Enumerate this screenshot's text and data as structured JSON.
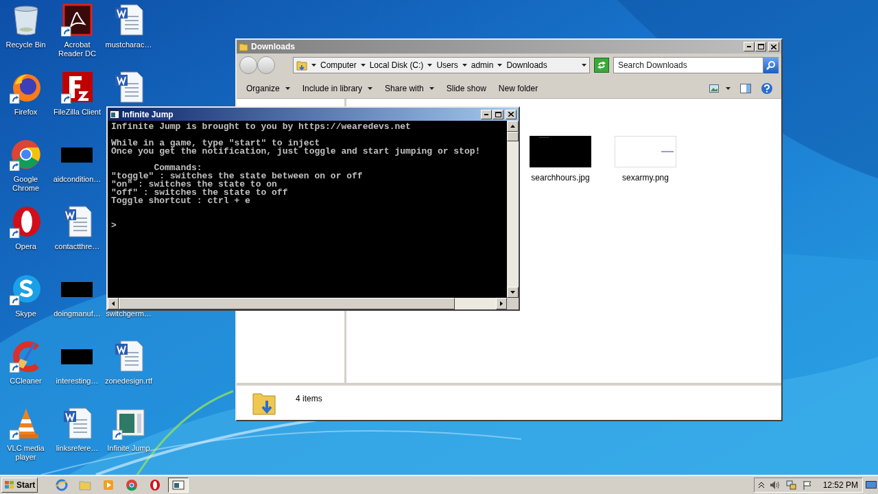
{
  "desktop": {
    "columns": [
      [
        {
          "label": "Recycle Bin",
          "kind": "recycle",
          "shortcut": false
        },
        {
          "label": "Firefox",
          "kind": "firefox",
          "shortcut": true
        },
        {
          "label": "Google Chrome",
          "kind": "chrome",
          "shortcut": true
        },
        {
          "label": "Opera",
          "kind": "opera",
          "shortcut": true
        },
        {
          "label": "Skype",
          "kind": "skype",
          "shortcut": true
        },
        {
          "label": "CCleaner",
          "kind": "ccleaner",
          "shortcut": true
        },
        {
          "label": "VLC media player",
          "kind": "vlc",
          "shortcut": true
        }
      ],
      [
        {
          "label": "Acrobat Reader DC",
          "kind": "acrobat",
          "shortcut": true
        },
        {
          "label": "FileZilla Client",
          "kind": "filezilla",
          "shortcut": true
        },
        {
          "label": "aidcondition…",
          "kind": "darkimage",
          "shortcut": false
        },
        {
          "label": "contactthre…",
          "kind": "word",
          "shortcut": false
        },
        {
          "label": "doingmanuf…",
          "kind": "darkimage",
          "shortcut": false
        },
        {
          "label": "interesting…",
          "kind": "darkimage",
          "shortcut": false
        },
        {
          "label": "linksrefere…",
          "kind": "word",
          "shortcut": false
        }
      ],
      [
        {
          "label": "mustcharac…",
          "kind": "word",
          "shortcut": false
        },
        {
          "kind": "word",
          "shortcut": false
        },
        {
          "kind": "none"
        },
        {
          "kind": "none"
        },
        {
          "label": "switchgerm…",
          "kind": "none"
        },
        {
          "label": "zonedesign.rtf",
          "kind": "word",
          "shortcut": false
        },
        {
          "label": "Infinite Jump",
          "kind": "app",
          "shortcut": true
        }
      ]
    ]
  },
  "explorer": {
    "title": "Downloads",
    "active": false,
    "breadcrumb": [
      "Computer",
      "Local Disk (C:)",
      "Users",
      "admin",
      "Downloads"
    ],
    "search": {
      "placeholder": "Search Downloads"
    },
    "toolbar": [
      {
        "label": "Organize",
        "menu": true
      },
      {
        "label": "Include in library",
        "menu": true
      },
      {
        "label": "Share with",
        "menu": true
      },
      {
        "label": "Slide show",
        "menu": false
      },
      {
        "label": "New folder",
        "menu": false
      }
    ],
    "files": [
      {
        "name": "searchhours.jpg",
        "kind": "dark"
      },
      {
        "name": "sexarmy.png",
        "kind": "light"
      }
    ],
    "status": "4 items"
  },
  "console": {
    "title": "Infinite Jump",
    "active": true,
    "paragraphs": [
      [
        "Infinite Jump is brought to you by https://wearedevs.net"
      ],
      [
        "While in a game, type \"start\" to inject",
        "Once you get the notification, just toggle and start jumping or stop!"
      ],
      [
        "        Commands:",
        "\"toggle\" : switches the state between on or off",
        "\"on\" : switches the state to on",
        "\"off\" : switches the state to off",
        "Toggle shortcut : ctrl + e"
      ]
    ],
    "prompt": ">"
  },
  "taskbar": {
    "start": "Start",
    "apps": [
      {
        "kind": "ie",
        "active": false
      },
      {
        "kind": "folder",
        "active": false
      },
      {
        "kind": "media",
        "active": false
      },
      {
        "kind": "chrome",
        "active": false
      },
      {
        "kind": "opera",
        "active": false
      },
      {
        "kind": "console",
        "active": true
      }
    ],
    "clock": "12:52 PM"
  }
}
